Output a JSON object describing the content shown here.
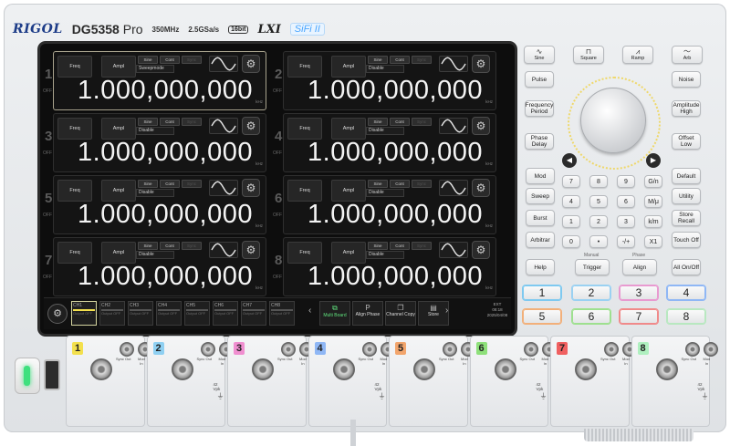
{
  "brand": {
    "logo": "RIGOL",
    "model": "DG5358",
    "model_suffix": "Pro",
    "bandwidth": "350MHz",
    "sample_rate": "2.5GSa/s",
    "bits": "16bit",
    "lxi": "LXI",
    "sifi": "SiFi II"
  },
  "channels": [
    {
      "num": "1",
      "state": "OFF",
      "freq_label": "Freq",
      "ampl_label": "Ampl",
      "sine": "Sine",
      "cont": "Cont",
      "sync": "Sync",
      "sub_label": "Sweepmode",
      "value": "1.000,000,000",
      "unit": "kHz"
    },
    {
      "num": "2",
      "state": "OFF",
      "freq_label": "Freq",
      "ampl_label": "Ampl",
      "sine": "Sine",
      "cont": "Cont",
      "sync": "Sync",
      "sub_label": "Disable",
      "value": "1.000,000,000",
      "unit": "kHz"
    },
    {
      "num": "3",
      "state": "OFF",
      "freq_label": "Freq",
      "ampl_label": "Ampl",
      "sine": "Sine",
      "cont": "Cont",
      "sync": "Sync",
      "sub_label": "Disable",
      "value": "1.000,000,000",
      "unit": "kHz"
    },
    {
      "num": "4",
      "state": "OFF",
      "freq_label": "Freq",
      "ampl_label": "Ampl",
      "sine": "Sine",
      "cont": "Cont",
      "sync": "Sync",
      "sub_label": "Disable",
      "value": "1.000,000,000",
      "unit": "kHz"
    },
    {
      "num": "5",
      "state": "OFF",
      "freq_label": "Freq",
      "ampl_label": "Ampl",
      "sine": "Sine",
      "cont": "Cont",
      "sync": "Sync",
      "sub_label": "Disable",
      "value": "1.000,000,000",
      "unit": "kHz"
    },
    {
      "num": "6",
      "state": "OFF",
      "freq_label": "Freq",
      "ampl_label": "Ampl",
      "sine": "Sine",
      "cont": "Cont",
      "sync": "Sync",
      "sub_label": "Disable",
      "value": "1.000,000,000",
      "unit": "kHz"
    },
    {
      "num": "7",
      "state": "OFF",
      "freq_label": "Freq",
      "ampl_label": "Ampl",
      "sine": "Sine",
      "cont": "Cont",
      "sync": "Sync",
      "sub_label": "Disable",
      "value": "1.000,000,000",
      "unit": "kHz"
    },
    {
      "num": "8",
      "state": "OFF",
      "freq_label": "Freq",
      "ampl_label": "Ampl",
      "sine": "Sine",
      "cont": "Cont",
      "sync": "Sync",
      "sub_label": "Disable",
      "value": "1.000,000,000",
      "unit": "kHz"
    }
  ],
  "statusbar": {
    "ch_tabs": [
      {
        "label": "CH1",
        "info": "Output OFF"
      },
      {
        "label": "CH2",
        "info": "Output OFF"
      },
      {
        "label": "CH3",
        "info": "Output OFF"
      },
      {
        "label": "CH4",
        "info": "Output OFF"
      },
      {
        "label": "CH5",
        "info": "Output OFF"
      },
      {
        "label": "CH6",
        "info": "Output OFF"
      },
      {
        "label": "CH7",
        "info": "Output OFF"
      },
      {
        "label": "CH8",
        "info": "Output OFF"
      }
    ],
    "funcs": [
      {
        "label": "Multi Board",
        "icon": "⧉"
      },
      {
        "label": "Align Phase",
        "icon": "P"
      },
      {
        "label": "Channel Copy",
        "icon": "❐"
      },
      {
        "label": "Store",
        "icon": "▤"
      }
    ],
    "sys_lines": [
      "EXT",
      "08:18",
      "2025/04/08"
    ]
  },
  "waveform_buttons": [
    {
      "label": "Sine",
      "icon": "∿"
    },
    {
      "label": "Square",
      "icon": "⊓"
    },
    {
      "label": "Ramp",
      "icon": "⩘"
    },
    {
      "label": "Arb",
      "icon": "〜"
    }
  ],
  "left_buttons": [
    {
      "label": "Pulse"
    },
    {
      "label": "Frequency Period"
    },
    {
      "label": "Phase Delay"
    }
  ],
  "right_buttons": [
    {
      "label": "Noise"
    },
    {
      "label": "Amplitude High"
    },
    {
      "label": "Offset Low"
    }
  ],
  "menu_buttons": [
    "Mod",
    "Sweep",
    "Burst",
    "Arbitrar",
    "Help"
  ],
  "keypad": [
    "7",
    "8",
    "9",
    "G/n",
    "4",
    "5",
    "6",
    "M/μ",
    "1",
    "2",
    "3",
    "k/m",
    "0",
    "•",
    "-/+",
    "X1"
  ],
  "system_buttons": [
    "Default",
    "Utility",
    "Store Recall",
    "Touch Off"
  ],
  "trigger_label": "Trigger",
  "trigger_top": "Manual",
  "align_label": "Align",
  "align_top": "Phase",
  "all_label": "All On/Off",
  "channel_buttons": [
    {
      "num": "1",
      "color": "#7ec9f0"
    },
    {
      "num": "2",
      "color": "#9ad1f2"
    },
    {
      "num": "3",
      "color": "#e89ad0"
    },
    {
      "num": "4",
      "color": "#8fb7f5"
    },
    {
      "num": "5",
      "color": "#f2b07a"
    },
    {
      "num": "6",
      "color": "#9ee08f"
    },
    {
      "num": "7",
      "color": "#f08a8a"
    },
    {
      "num": "8",
      "color": "#b8e8c0"
    }
  ],
  "output_slots": [
    {
      "num": "1",
      "color": "#f3e04d"
    },
    {
      "num": "2",
      "color": "#8fd0f2"
    },
    {
      "num": "3",
      "color": "#f08fd0"
    },
    {
      "num": "4",
      "color": "#8fb7f5"
    },
    {
      "num": "5",
      "color": "#f2a56c"
    },
    {
      "num": "6",
      "color": "#8ee07a"
    },
    {
      "num": "7",
      "color": "#f06060"
    },
    {
      "num": "8",
      "color": "#b0f0c0"
    }
  ],
  "jack_labels": {
    "sync": "Sync Out",
    "mod": "Mod In",
    "voltage": "42 Vpk"
  }
}
